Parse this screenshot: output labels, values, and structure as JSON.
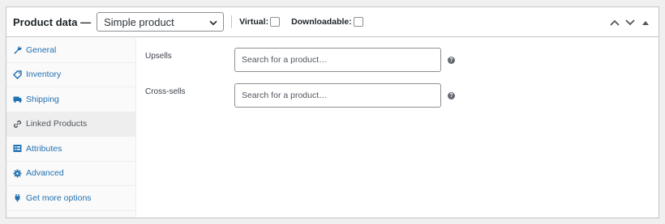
{
  "header": {
    "title": "Product data —",
    "product_type": "Simple product",
    "virtual_label": "Virtual:",
    "downloadable_label": "Downloadable:"
  },
  "sidebar": {
    "items": [
      {
        "label": "General",
        "icon": "wrench-icon",
        "active": false
      },
      {
        "label": "Inventory",
        "icon": "tag-icon",
        "active": false
      },
      {
        "label": "Shipping",
        "icon": "truck-icon",
        "active": false
      },
      {
        "label": "Linked Products",
        "icon": "link-icon",
        "active": true
      },
      {
        "label": "Attributes",
        "icon": "list-icon",
        "active": false
      },
      {
        "label": "Advanced",
        "icon": "gear-icon",
        "active": false
      },
      {
        "label": "Get more options",
        "icon": "plugin-icon",
        "active": false
      }
    ]
  },
  "fields": {
    "upsells": {
      "label": "Upsells",
      "placeholder": "Search for a product…"
    },
    "cross_sells": {
      "label": "Cross-sells",
      "placeholder": "Search for a product…"
    }
  },
  "colors": {
    "link": "#2271b1",
    "border": "#c3c4c7",
    "active_tab_bg": "#eeeeee"
  }
}
